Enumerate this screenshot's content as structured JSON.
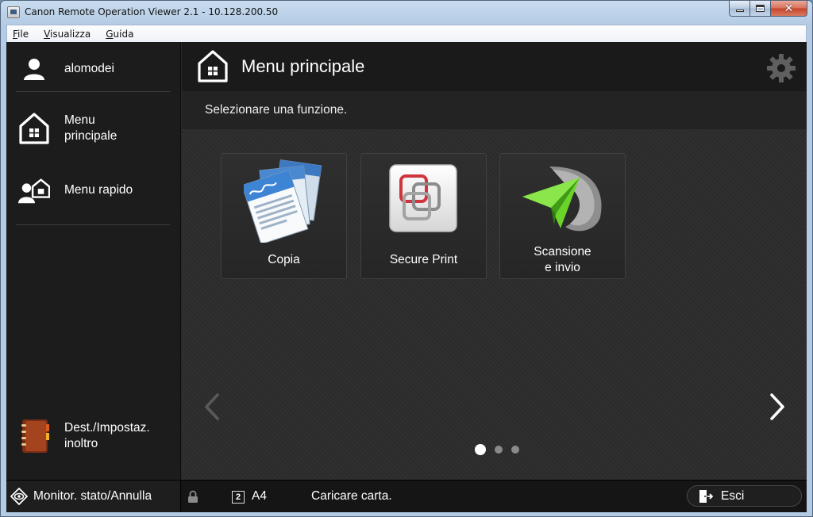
{
  "window": {
    "title": "Canon Remote Operation Viewer 2.1 - 10.128.200.50",
    "min_label": "",
    "close_glyph": "✕"
  },
  "menubar": {
    "items": [
      {
        "first": "F",
        "rest": "ile"
      },
      {
        "first": "V",
        "rest": "isualizza"
      },
      {
        "first": "G",
        "rest": "uida"
      }
    ]
  },
  "sidebar": {
    "user": {
      "label": "alomodei",
      "icon": "user-icon"
    },
    "items": [
      {
        "label": "Menu\nprincipale",
        "icon": "home-icon"
      },
      {
        "label": "Menu rapido",
        "icon": "quick-menu-icon"
      }
    ],
    "dest": {
      "label": "Dest./Impostaz.\ninoltro",
      "icon": "address-book-icon"
    }
  },
  "main": {
    "title": "Menu principale",
    "prompt": "Selezionare una funzione.",
    "tiles": [
      {
        "label": "Copia",
        "icon": "copy-icon"
      },
      {
        "label": "Secure Print",
        "icon": "secure-print-icon"
      },
      {
        "label": "Scansione\ne invio",
        "icon": "scan-send-icon"
      }
    ],
    "pages": {
      "count": 3,
      "current": 1
    }
  },
  "status": {
    "monitor_label": "Monitor. stato/Annulla",
    "paper_tray": "2",
    "paper_size": "A4",
    "message": "Caricare carta.",
    "exit_label": "Esci"
  },
  "colors": {
    "background": "#2a2a2a",
    "sidebar": "#1c1c1c",
    "header": "#1a1a1a",
    "text": "#ffffff",
    "accent_green": "#6bd42a",
    "accent_red": "#d0343e"
  }
}
